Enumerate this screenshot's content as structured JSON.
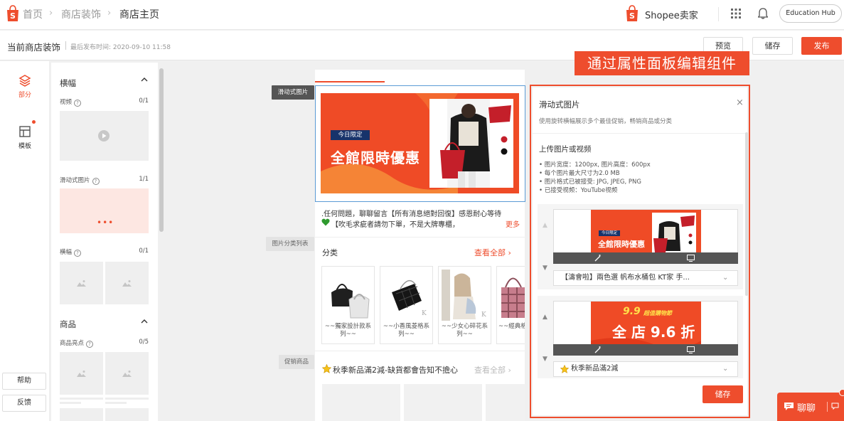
{
  "topnav": {
    "breadcrumb": [
      "首页",
      "商店装饰",
      "商店主页"
    ],
    "seller_brand": "Shopee卖家",
    "edu_hub": "Education Hub"
  },
  "subheader": {
    "title": "当前商店装饰",
    "last_published": "最后发布时间: 2020-09-10 11:58",
    "preview": "预览",
    "save": "储存",
    "publish": "发布"
  },
  "rail": {
    "sections": "部分",
    "templates": "模板",
    "help": "帮助",
    "feedback": "反馈"
  },
  "components": {
    "banner_group": "横幅",
    "video": {
      "label": "视频",
      "count": "0/1"
    },
    "slider": {
      "label": "滑动式图片",
      "count": "1/1"
    },
    "banner": {
      "label": "横幅",
      "count": "0/1"
    },
    "product_group": "商品",
    "product_highlight": {
      "label": "商品亮点",
      "count": "0/5"
    },
    "help_mark": "?"
  },
  "canvas": {
    "tag_slider": "滑动式图片",
    "tag_category": "图片分类列表",
    "tag_promo": "促销商品",
    "banner_badge": "今日限定",
    "banner_title": "全館限時優惠",
    "notice_line1": ".任何問題，聊聊留言【所有消息絕對回復】感恩耐心等待",
    "notice_line2": "【吹毛求疵者請勿下單，不是大牌專櫃，",
    "notice_more": "更多",
    "category_title": "分类",
    "category_all": "查看全部",
    "categories": [
      "~~獨家設計款系列~~",
      "~~小香風菱格系列~~",
      "~~少女心碎花系列~~",
      "~~經典格"
    ],
    "promo_title": "秋季新品滿2減-缺貨都會告知不擔心",
    "promo_all": "查看全部"
  },
  "properties": {
    "callout": "通过属性面板编辑组件",
    "title": "滑动式图片",
    "close": "×",
    "description": "使用旋转横幅展示多个最佳促销，畅销商品或分类",
    "upload_title": "上传图片或视频",
    "specs": [
      "图片宽度：1200px, 图片高度：600px",
      "每个图片最大尺寸为2.0 MB",
      "图片格式已被接受: JPG, JPEG, PNG",
      "已接受视频：YouTube视频"
    ],
    "slot1": {
      "badge": "今日限定",
      "title": "全館限時優惠",
      "link": "【濤會啦】兩色選 帆布水桶包 KT家 手..."
    },
    "slot2": {
      "headline": "9.9",
      "sub": "超值購物節",
      "title": "全 店 9.6 折",
      "link": "秋季新品滿2減"
    },
    "save": "储存"
  },
  "chat": {
    "label": "聊聊"
  },
  "colors": {
    "accent": "#ee4d2d",
    "selection": "#5b9bd5",
    "badge_navy": "#17336b"
  }
}
